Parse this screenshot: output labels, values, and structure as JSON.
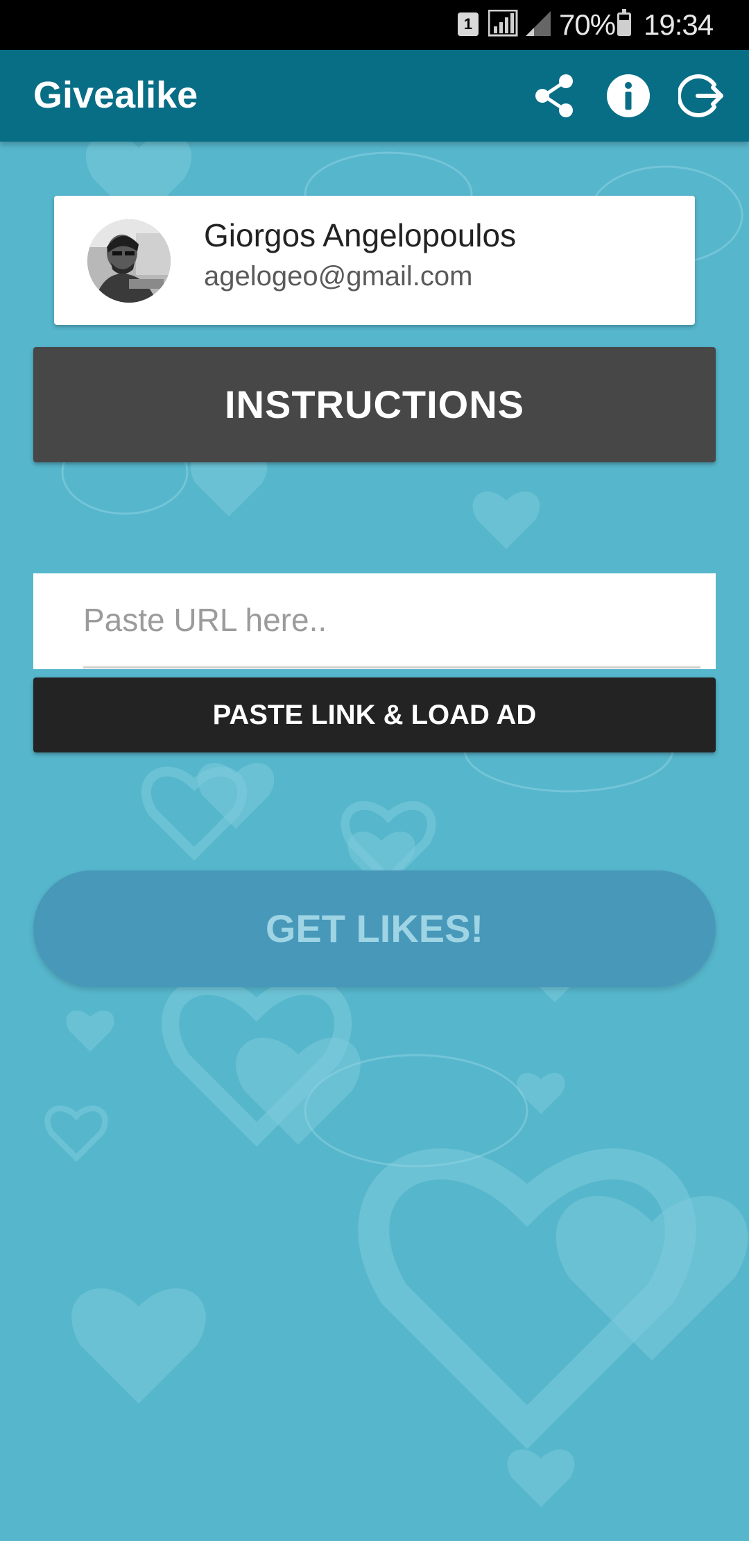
{
  "status_bar": {
    "sim": "1",
    "battery": "70%",
    "time": "19:34"
  },
  "app_bar": {
    "title": "Givealike",
    "icons": [
      "share-icon",
      "info-icon",
      "logout-icon"
    ]
  },
  "profile": {
    "name": "Giorgos Angelopoulos",
    "email": "agelogeo@gmail.com"
  },
  "instructions": {
    "label": "INSTRUCTIONS"
  },
  "url_field": {
    "placeholder": "Paste URL here..",
    "value": ""
  },
  "paste_button": {
    "label": "PASTE LINK & LOAD AD"
  },
  "get_likes_button": {
    "label": "GET LIKES!"
  },
  "colors": {
    "background": "#56b6cc",
    "app_bar": "#076e86",
    "instructions_button": "#474747",
    "paste_button": "#232323",
    "get_likes_button": "#4898ba"
  }
}
